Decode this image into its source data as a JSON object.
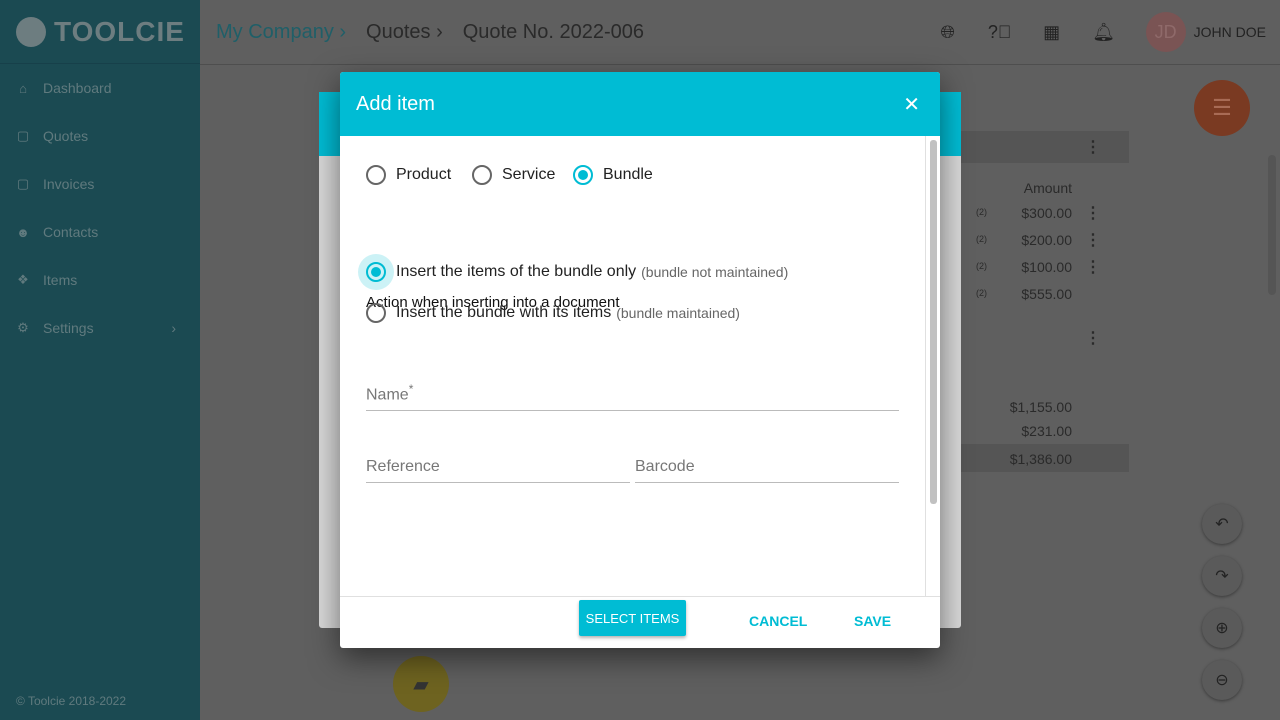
{
  "app": {
    "logo": "TOOLCIE",
    "copyright": "© Toolcie 2018-2022"
  },
  "sidebar": {
    "items": [
      {
        "label": "Dashboard",
        "icon": "home-icon"
      },
      {
        "label": "Quotes",
        "icon": "quote-icon"
      },
      {
        "label": "Invoices",
        "icon": "invoice-icon"
      },
      {
        "label": "Contacts",
        "icon": "contacts-icon"
      },
      {
        "label": "Items",
        "icon": "items-icon"
      },
      {
        "label": "Settings",
        "icon": "gear-icon"
      }
    ]
  },
  "header": {
    "breadcrumb": [
      "My Company",
      "Quotes",
      "Quote No. 2022-006"
    ],
    "user_initials": "JD",
    "user_name": "JOHN DOE"
  },
  "background_table": {
    "amount_header": "Amount",
    "rows": [
      {
        "qty": "(2)",
        "amount": "$300.00"
      },
      {
        "qty": "(2)",
        "amount": "$200.00"
      },
      {
        "qty": "(2)",
        "amount": "$100.00"
      },
      {
        "qty": "(2)",
        "amount": "$555.00"
      }
    ],
    "subtotal": "$1,155.00",
    "tax": "$231.00",
    "total": "$1,386.00"
  },
  "dialog": {
    "title": "Add item",
    "types": [
      {
        "label": "Product",
        "selected": false
      },
      {
        "label": "Service",
        "selected": false
      },
      {
        "label": "Bundle",
        "selected": true
      }
    ],
    "action_label": "Action when inserting into a document",
    "actions": [
      {
        "label": "Insert the items of the bundle only",
        "hint": "(bundle not maintained)",
        "selected": true
      },
      {
        "label": "Insert the bundle with its items",
        "hint": "(bundle maintained)",
        "selected": false
      }
    ],
    "name_label": "Name",
    "required_mark": "*",
    "reference_label": "Reference",
    "barcode_label": "Barcode",
    "select_items": "SELECT ITEMS",
    "cancel": "CANCEL",
    "save": "SAVE"
  },
  "colors": {
    "accent": "#00bcd4",
    "fab": "#e0592a"
  }
}
